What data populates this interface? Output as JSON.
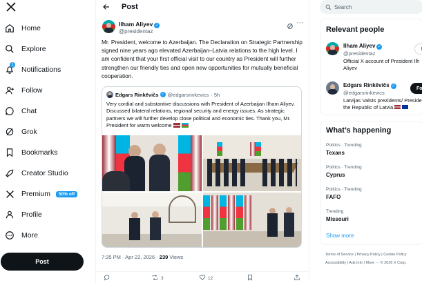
{
  "nav": {
    "items": [
      {
        "label": "Home",
        "icon": "home-icon"
      },
      {
        "label": "Explore",
        "icon": "search-icon"
      },
      {
        "label": "Notifications",
        "icon": "bell-icon",
        "badge": "1"
      },
      {
        "label": "Follow",
        "icon": "person-add-icon"
      },
      {
        "label": "Chat",
        "icon": "chat-icon"
      },
      {
        "label": "Grok",
        "icon": "grok-icon"
      },
      {
        "label": "Bookmarks",
        "icon": "bookmark-icon"
      },
      {
        "label": "Creator Studio",
        "icon": "rocket-icon"
      },
      {
        "label": "Premium",
        "icon": "x-icon",
        "badge": "50% off"
      },
      {
        "label": "Profile",
        "icon": "person-icon"
      },
      {
        "label": "More",
        "icon": "more-circle-icon"
      }
    ],
    "post_button": "Post"
  },
  "header": {
    "title": "Post"
  },
  "tweet": {
    "author": "Ilham Aliyev",
    "handle": "@presidentaz",
    "text": "Mr. President, welcome to Azerbaijan. The Declaration on Strategic Partnership signed nine years ago elevated Azerbaijan–Latvia relations to the high level. I am confident that your first official visit to our country as President will further strengthen our friendly ties and open new opportunities for mutually beneficial cooperation.",
    "quote": {
      "author": "Edgars Rinkēvičs",
      "handle": "@edgarsrinkevics",
      "time": "· 5h",
      "text": "Very cordial and substantive discussions with President of Azerbaijan Ilham Aliyev. Discussed bilateral relations, regional security and energy issues. As strategic partners we will further develop close political and economic ties. Thank you, Mr. President for warm welcome"
    },
    "time": "7:35 PM · Apr 22, 2026 · ",
    "views_count": "239",
    "views_label": " Views",
    "replies": "",
    "reposts": "3",
    "likes": "12"
  },
  "search": {
    "placeholder": "Search"
  },
  "relevant": {
    "title": "Relevant people",
    "people": [
      {
        "name": "Ilham Aliyev",
        "handle": "@presidentaz",
        "bio_line1": "Official X account of President Ilh",
        "bio_line2": "Aliyev",
        "button": "Follow"
      },
      {
        "name": "Edgars Rinkēvičs",
        "handle": "@edgarsrinkevics",
        "bio_line1": "Latvijas Valsts prezidents/ Preside",
        "bio_line2": "the Republic of Latvia",
        "button": "Follow"
      }
    ]
  },
  "happening": {
    "title": "What’s happening",
    "trends": [
      {
        "category": "Politics · Trending",
        "name": "Texans"
      },
      {
        "category": "Politics · Trending",
        "name": "Cyprus"
      },
      {
        "category": "Politics · Trending",
        "name": "FAFO"
      },
      {
        "category": "Trending",
        "name": "Missouri"
      }
    ],
    "show_more": "Show more"
  },
  "footer": {
    "line1": [
      "Terms of Service",
      "|",
      "Privacy Policy",
      "|",
      "Cookie Policy"
    ],
    "line2": [
      "Accessibility",
      "|",
      "Ads info",
      "|",
      "More ···",
      "© 2026 X Corp."
    ]
  },
  "colors": {
    "accent": "#1d9bf0",
    "text": "#0f1419",
    "muted": "#536471",
    "border": "#eff3f4"
  }
}
